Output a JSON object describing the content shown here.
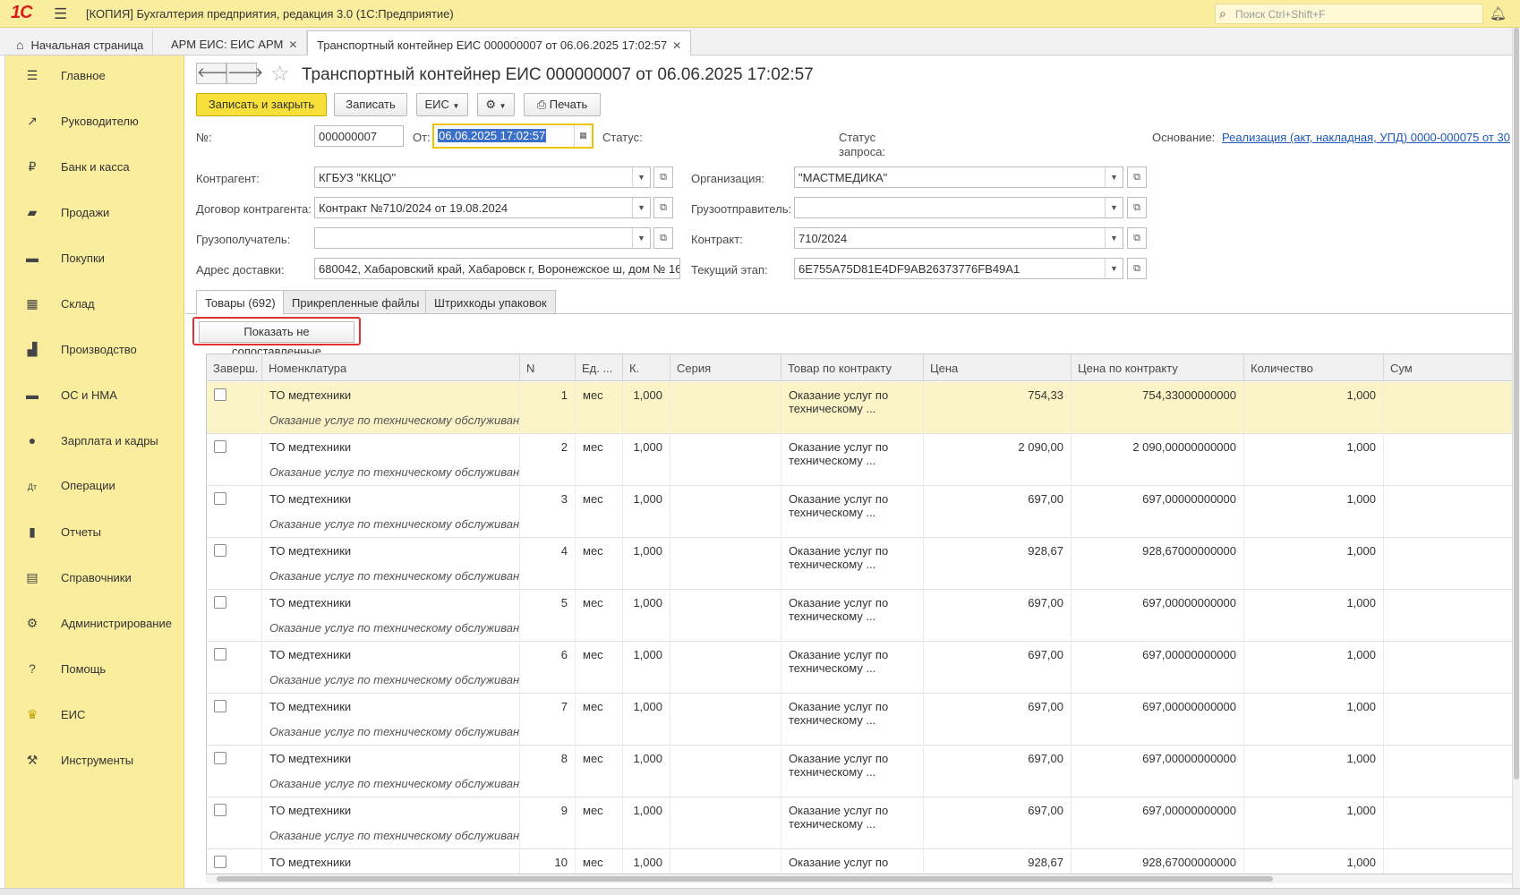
{
  "app": {
    "logo": "1С",
    "title": "[КОПИЯ] Бухгалтерия предприятия, редакция 3.0  (1С:Предприятие)",
    "search_placeholder": "Поиск Ctrl+Shift+F"
  },
  "tabs": [
    {
      "label": "Начальная страница"
    },
    {
      "label": "АРМ ЕИС: ЕИС АРМ"
    },
    {
      "label": "Транспортный контейнер ЕИС 000000007 от 06.06.2025 17:02:57"
    }
  ],
  "sidebar": [
    {
      "label": "Главное",
      "icon": "menu-icon"
    },
    {
      "label": "Руководителю",
      "icon": "trend-icon"
    },
    {
      "label": "Банк и касса",
      "icon": "ruble-icon"
    },
    {
      "label": "Продажи",
      "icon": "bag-icon"
    },
    {
      "label": "Покупки",
      "icon": "cart-icon"
    },
    {
      "label": "Склад",
      "icon": "warehouse-icon"
    },
    {
      "label": "Производство",
      "icon": "factory-icon"
    },
    {
      "label": "ОС и НМА",
      "icon": "truck-icon"
    },
    {
      "label": "Зарплата и кадры",
      "icon": "person-icon"
    },
    {
      "label": "Операции",
      "icon": "dt-kt-icon"
    },
    {
      "label": "Отчеты",
      "icon": "bar-chart-icon"
    },
    {
      "label": "Справочники",
      "icon": "books-icon"
    },
    {
      "label": "Администрирование",
      "icon": "gear-icon"
    },
    {
      "label": "Помощь",
      "icon": "question-icon"
    },
    {
      "label": "ЕИС",
      "icon": "emblem-icon"
    },
    {
      "label": "Инструменты",
      "icon": "tools-icon"
    }
  ],
  "doc": {
    "title": "Транспортный контейнер ЕИС 000000007 от 06.06.2025 17:02:57",
    "buttons": {
      "save_close": "Записать и закрыть",
      "save": "Записать",
      "eis": "ЕИС",
      "print": "Печать"
    },
    "fields": {
      "number_label": "№:",
      "number": "000000007",
      "date_label": "От:",
      "date": "06.06.2025 17:02:57",
      "status_label": "Статус:",
      "request_status_label": "Статус\nзапроса:",
      "basis_label": "Основание:",
      "basis": "Реализация (акт, накладная, УПД) 0000-000075 от 30",
      "counterparty_label": "Контрагент:",
      "counterparty": "КГБУЗ \"ККЦО\"",
      "org_label": "Организация:",
      "org": "\"МАСТМЕДИКА\"",
      "contract_cp_label": "Договор контрагента:",
      "contract_cp": "Контракт №710/2024 от 19.08.2024",
      "shipper_label": "Грузоотправитель:",
      "shipper": "",
      "consignee_label": "Грузополучатель:",
      "consignee": "",
      "contract_label": "Контракт:",
      "contract": "710/2024",
      "address_label": "Адрес доставки:",
      "address": "680042, Хабаровский край, Хабаровск г, Воронежское ш, дом № 16",
      "stage_label": "Текущий этап:",
      "stage": "6E755A75D81E4DF9AB26373776FB49A1"
    },
    "page_tabs": [
      "Товары (692)",
      "Прикрепленные файлы",
      "Штрихкоды упаковок"
    ],
    "show_unmatched": "Показать не сопоставленные"
  },
  "table": {
    "headers": [
      "Заверш.",
      "Номенклатура",
      "N",
      "Ед. ...",
      "К.",
      "Серия",
      "Товар по контракту",
      "Цена",
      "Цена по контракту",
      "Количество",
      "Сум"
    ],
    "rows": [
      {
        "name": "ТО медтехники",
        "desc": "Оказание услуг по техническому обслуживан...",
        "n": "1",
        "unit": "мес",
        "k": "1,000",
        "series": "",
        "contract_item": "Оказание услуг по техническому ...",
        "price": "754,33",
        "contract_price": "754,33000000000",
        "qty": "1,000"
      },
      {
        "name": "ТО медтехники",
        "desc": "Оказание услуг по техническому обслуживан...",
        "n": "2",
        "unit": "мес",
        "k": "1,000",
        "series": "",
        "contract_item": "Оказание услуг по техническому ...",
        "price": "2 090,00",
        "contract_price": "2 090,00000000000",
        "qty": "1,000"
      },
      {
        "name": "ТО медтехники",
        "desc": "Оказание услуг по техническому обслуживан...",
        "n": "3",
        "unit": "мес",
        "k": "1,000",
        "series": "",
        "contract_item": "Оказание услуг по техническому ...",
        "price": "697,00",
        "contract_price": "697,00000000000",
        "qty": "1,000"
      },
      {
        "name": "ТО медтехники",
        "desc": "Оказание услуг по техническому обслуживан...",
        "n": "4",
        "unit": "мес",
        "k": "1,000",
        "series": "",
        "contract_item": "Оказание услуг по техническому ...",
        "price": "928,67",
        "contract_price": "928,67000000000",
        "qty": "1,000"
      },
      {
        "name": "ТО медтехники",
        "desc": "Оказание услуг по техническому обслуживан...",
        "n": "5",
        "unit": "мес",
        "k": "1,000",
        "series": "",
        "contract_item": "Оказание услуг по техническому ...",
        "price": "697,00",
        "contract_price": "697,00000000000",
        "qty": "1,000"
      },
      {
        "name": "ТО медтехники",
        "desc": "Оказание услуг по техническому обслуживан...",
        "n": "6",
        "unit": "мес",
        "k": "1,000",
        "series": "",
        "contract_item": "Оказание услуг по техническому ...",
        "price": "697,00",
        "contract_price": "697,00000000000",
        "qty": "1,000"
      },
      {
        "name": "ТО медтехники",
        "desc": "Оказание услуг по техническому обслуживан...",
        "n": "7",
        "unit": "мес",
        "k": "1,000",
        "series": "",
        "contract_item": "Оказание услуг по техническому ...",
        "price": "697,00",
        "contract_price": "697,00000000000",
        "qty": "1,000"
      },
      {
        "name": "ТО медтехники",
        "desc": "Оказание услуг по техническому обслуживан...",
        "n": "8",
        "unit": "мес",
        "k": "1,000",
        "series": "",
        "contract_item": "Оказание услуг по техническому ...",
        "price": "697,00",
        "contract_price": "697,00000000000",
        "qty": "1,000"
      },
      {
        "name": "ТО медтехники",
        "desc": "Оказание услуг по техническому обслуживан...",
        "n": "9",
        "unit": "мес",
        "k": "1,000",
        "series": "",
        "contract_item": "Оказание услуг по техническому ...",
        "price": "697,00",
        "contract_price": "697,00000000000",
        "qty": "1,000"
      },
      {
        "name": "ТО медтехники",
        "desc": "",
        "n": "10",
        "unit": "мес",
        "k": "1,000",
        "series": "",
        "contract_item": "Оказание услуг по",
        "price": "928,67",
        "contract_price": "928,67000000000",
        "qty": "1,000"
      }
    ]
  }
}
